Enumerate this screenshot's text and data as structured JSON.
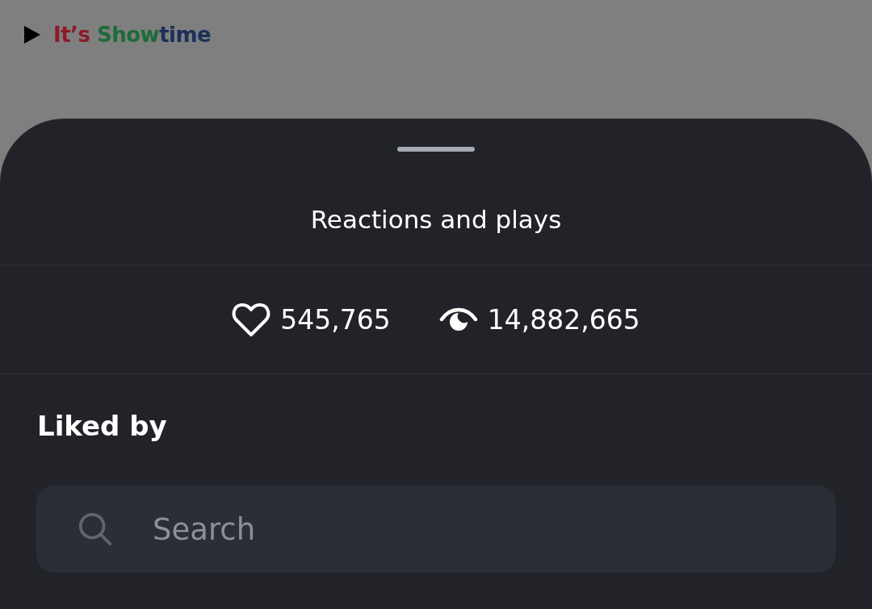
{
  "background": {
    "logo": [
      {
        "text": "It’s ",
        "color": "#8b1a2b"
      },
      {
        "text": "Show",
        "color": "#1e6b3a"
      },
      {
        "text": "time",
        "color": "#1c2f5a"
      }
    ]
  },
  "sheet": {
    "title": "Reactions and plays",
    "stats": [
      {
        "kind": "likes",
        "value": "545,765"
      },
      {
        "kind": "plays",
        "value": "14,882,665"
      }
    ],
    "section_title": "Liked by",
    "search": {
      "placeholder": "Search"
    }
  }
}
